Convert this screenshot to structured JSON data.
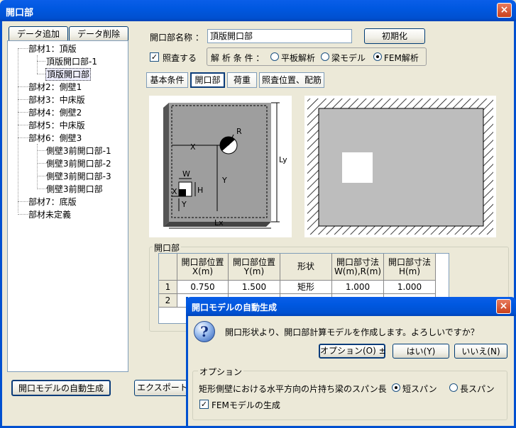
{
  "window": {
    "title": "開口部",
    "close": "×"
  },
  "toolbar": {
    "add_label": "データ追加",
    "delete_label": "データ削除"
  },
  "tree": {
    "items": [
      {
        "label": "部材1：頂版"
      },
      {
        "label": "頂版開口部-1"
      },
      {
        "label": "頂版開口部"
      },
      {
        "label": "部材2：側壁1"
      },
      {
        "label": "部材3：中床版"
      },
      {
        "label": "部材4：側壁2"
      },
      {
        "label": "部材5：中床版"
      },
      {
        "label": "部材6：側壁3"
      },
      {
        "label": "側壁3前開口部-1"
      },
      {
        "label": "側壁3前開口部-2"
      },
      {
        "label": "側壁3前開口部-3"
      },
      {
        "label": "側壁3前開口部"
      },
      {
        "label": "部材7：底版"
      },
      {
        "label": "部材未定義"
      }
    ]
  },
  "form": {
    "name_label": "開口部名称 ：",
    "name_value": "頂版開口部",
    "init_button": "初期化",
    "check_label": "照査する",
    "check_mark": "✓",
    "analysis_label": "解 析 条 件 ：",
    "analysis_options": [
      {
        "label": "平板解析",
        "selected": false
      },
      {
        "label": "梁モデル",
        "selected": false
      },
      {
        "label": "FEM解析",
        "selected": true
      }
    ]
  },
  "tabs": [
    {
      "label": "基本条件",
      "active": false
    },
    {
      "label": "開口部",
      "active": true
    },
    {
      "label": "荷重",
      "active": false
    },
    {
      "label": "照査位置、配筋",
      "active": false
    }
  ],
  "diagram": {
    "labels": {
      "r": "R",
      "x": "X",
      "y": "Y",
      "w": "W",
      "h": "H",
      "x2": "X",
      "y2": "Y",
      "lx": "Lx",
      "ly": "Ly"
    }
  },
  "table": {
    "group_label": "開口部",
    "columns": [
      {
        "line1": "開口部位置",
        "line2": "X(m)"
      },
      {
        "line1": "開口部位置",
        "line2": "Y(m)"
      },
      {
        "line1": "形状",
        "line2": ""
      },
      {
        "line1": "開口部寸法",
        "line2": "W(m),R(m)"
      },
      {
        "line1": "開口部寸法",
        "line2": "H(m)"
      }
    ],
    "rows": [
      {
        "num": "1",
        "cells": [
          "0.750",
          "1.500",
          "矩形",
          "1.000",
          "1.000"
        ]
      },
      {
        "num": "2",
        "cells": [
          "",
          "",
          "",
          "",
          ""
        ]
      }
    ]
  },
  "footer": {
    "auto_button": "開口モデルの自動生成",
    "export_button": "エクスポート"
  },
  "dialog": {
    "title": "開口モデルの自動生成",
    "close": "×",
    "message": "開口形状より、開口部計算モデルを作成します。よろしいですか？",
    "icon": "question-icon",
    "option_button": "オプション(O) ±",
    "yes_button": "はい(Y)",
    "no_button": "いいえ(N)",
    "option_group": "オプション",
    "span_label": "矩形側壁における水平方向の片持ち梁のスパン長",
    "span_options": [
      {
        "label": "短スパン",
        "selected": true
      },
      {
        "label": "長スパン",
        "selected": false
      }
    ],
    "fem_label": "FEMモデルの生成",
    "fem_checked": "✓"
  }
}
